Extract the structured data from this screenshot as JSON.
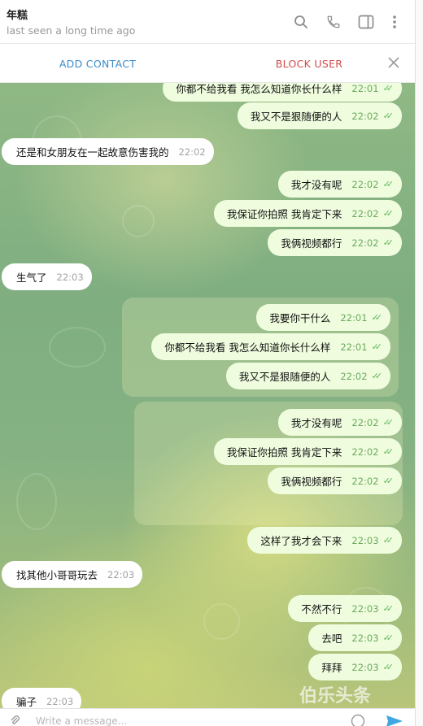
{
  "header": {
    "title": "年糕",
    "status": "last seen a long time ago"
  },
  "actions": {
    "add_contact": "ADD CONTACT",
    "block_user": "BLOCK USER"
  },
  "messages": [
    {
      "text": "你都不给我看 我怎么知道你长什么样",
      "time": "22:01",
      "dir": "out"
    },
    {
      "text": "我又不是狠随便的人",
      "time": "22:02",
      "dir": "out"
    },
    {
      "text": "还是和女朋友在一起故意伤害我的",
      "time": "22:02",
      "dir": "in"
    },
    {
      "text": "我才没有呢",
      "time": "22:02",
      "dir": "out"
    },
    {
      "text": "我保证你拍照 我肯定下来",
      "time": "22:02",
      "dir": "out"
    },
    {
      "text": "我俩视频都行",
      "time": "22:02",
      "dir": "out"
    },
    {
      "text": "生气了",
      "time": "22:03",
      "dir": "in"
    },
    {
      "text": "我要你干什么",
      "time": "22:01",
      "dir": "out"
    },
    {
      "text": "你都不给我看 我怎么知道你长什么样",
      "time": "22:01",
      "dir": "out"
    },
    {
      "text": "我又不是狠随便的人",
      "time": "22:02",
      "dir": "out"
    },
    {
      "text": "我才没有呢",
      "time": "22:02",
      "dir": "out"
    },
    {
      "text": "我保证你拍照 我肯定下来",
      "time": "22:02",
      "dir": "out"
    },
    {
      "text": "我俩视频都行",
      "time": "22:02",
      "dir": "out"
    },
    {
      "text": "这样了我才会下来",
      "time": "22:03",
      "dir": "out"
    },
    {
      "text": "找其他小哥哥玩去",
      "time": "22:03",
      "dir": "in"
    },
    {
      "text": "不然不行",
      "time": "22:03",
      "dir": "out"
    },
    {
      "text": "去吧",
      "time": "22:03",
      "dir": "out"
    },
    {
      "text": "拜拜",
      "time": "22:03",
      "dir": "out"
    },
    {
      "text": "骗子",
      "time": "22:03",
      "dir": "in"
    }
  ],
  "input": {
    "placeholder": "Write a message..."
  },
  "watermark": "伯乐头条",
  "icons": {
    "search": "search-icon",
    "phone": "phone-icon",
    "panel": "sidebar-toggle-icon",
    "more": "more-vertical-icon",
    "close": "close-icon",
    "read": "double-check-icon",
    "attach": "paperclip-icon",
    "emoji": "emoji-icon",
    "send": "send-icon"
  },
  "colors": {
    "outgoing_bubble": "#effdde",
    "incoming_bubble": "#ffffff",
    "add_contact": "#3a8cc9",
    "block_user": "#d14b4b",
    "check": "#62b45c"
  }
}
